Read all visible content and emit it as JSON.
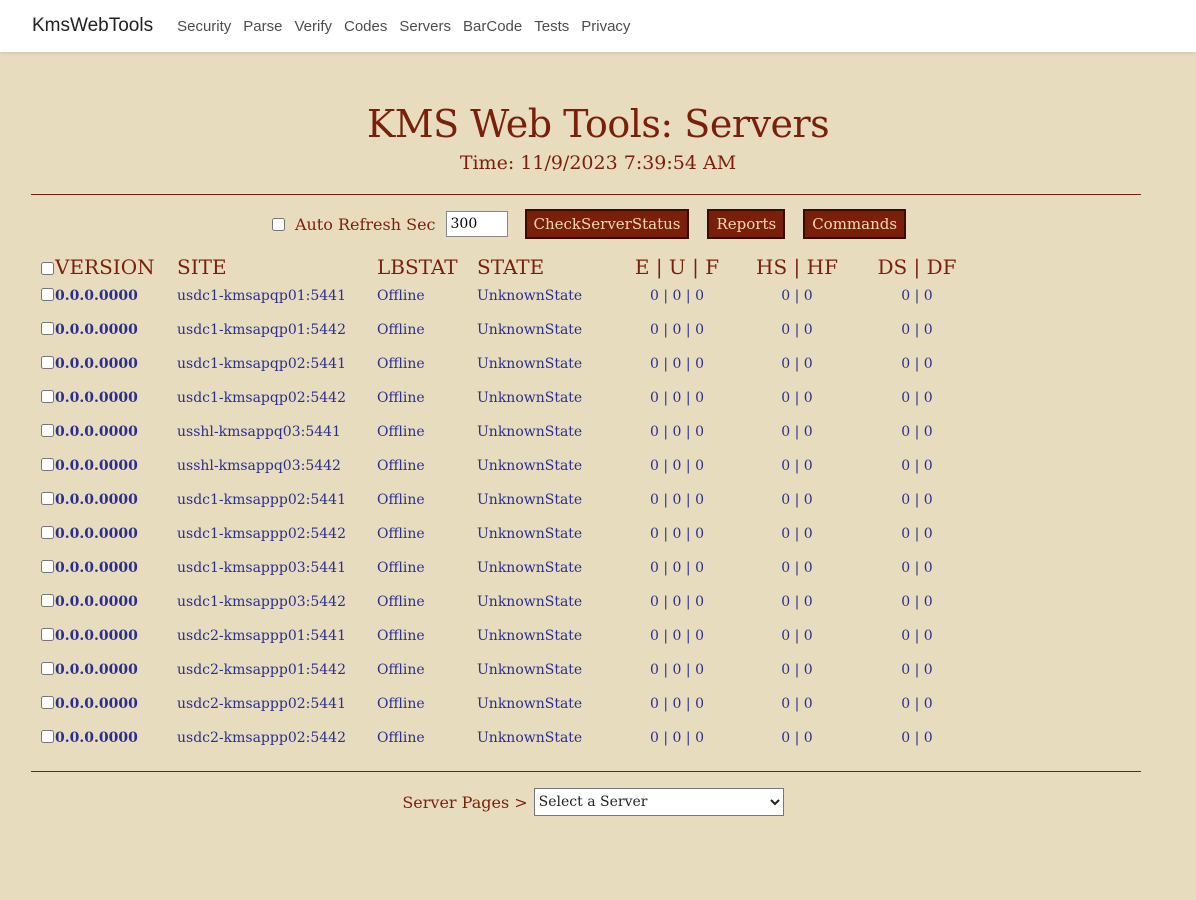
{
  "nav": {
    "brand": "KmsWebTools",
    "items": [
      {
        "label": "Security"
      },
      {
        "label": "Parse"
      },
      {
        "label": "Verify"
      },
      {
        "label": "Codes"
      },
      {
        "label": "Servers"
      },
      {
        "label": "BarCode"
      },
      {
        "label": "Tests"
      },
      {
        "label": "Privacy"
      }
    ]
  },
  "header": {
    "title": "KMS Web Tools: Servers",
    "time": "Time: 11/9/2023 7:39:54 AM"
  },
  "controls": {
    "auto_refresh_label": "Auto Refresh Sec",
    "auto_refresh_value": "300",
    "auto_refresh_checked": false,
    "check_status_label": "CheckServerStatus",
    "reports_label": "Reports",
    "commands_label": "Commands"
  },
  "table": {
    "headers": [
      "VERSION",
      "SITE",
      "LBSTAT",
      "STATE",
      "E | U | F",
      "HS | HF",
      "DS | DF"
    ],
    "rows": [
      {
        "version": "0.0.0.0000",
        "site": "usdc1-kmsapqp01:5441",
        "lbstat": "Offline",
        "state": "UnknownState",
        "euf": "0 | 0 | 0",
        "hshf": "0 | 0",
        "dsdf": "0 | 0"
      },
      {
        "version": "0.0.0.0000",
        "site": "usdc1-kmsapqp01:5442",
        "lbstat": "Offline",
        "state": "UnknownState",
        "euf": "0 | 0 | 0",
        "hshf": "0 | 0",
        "dsdf": "0 | 0"
      },
      {
        "version": "0.0.0.0000",
        "site": "usdc1-kmsapqp02:5441",
        "lbstat": "Offline",
        "state": "UnknownState",
        "euf": "0 | 0 | 0",
        "hshf": "0 | 0",
        "dsdf": "0 | 0"
      },
      {
        "version": "0.0.0.0000",
        "site": "usdc1-kmsapqp02:5442",
        "lbstat": "Offline",
        "state": "UnknownState",
        "euf": "0 | 0 | 0",
        "hshf": "0 | 0",
        "dsdf": "0 | 0"
      },
      {
        "version": "0.0.0.0000",
        "site": "usshl-kmsappq03:5441",
        "lbstat": "Offline",
        "state": "UnknownState",
        "euf": "0 | 0 | 0",
        "hshf": "0 | 0",
        "dsdf": "0 | 0"
      },
      {
        "version": "0.0.0.0000",
        "site": "usshl-kmsappq03:5442",
        "lbstat": "Offline",
        "state": "UnknownState",
        "euf": "0 | 0 | 0",
        "hshf": "0 | 0",
        "dsdf": "0 | 0"
      },
      {
        "version": "0.0.0.0000",
        "site": "usdc1-kmsappp02:5441",
        "lbstat": "Offline",
        "state": "UnknownState",
        "euf": "0 | 0 | 0",
        "hshf": "0 | 0",
        "dsdf": "0 | 0"
      },
      {
        "version": "0.0.0.0000",
        "site": "usdc1-kmsappp02:5442",
        "lbstat": "Offline",
        "state": "UnknownState",
        "euf": "0 | 0 | 0",
        "hshf": "0 | 0",
        "dsdf": "0 | 0"
      },
      {
        "version": "0.0.0.0000",
        "site": "usdc1-kmsappp03:5441",
        "lbstat": "Offline",
        "state": "UnknownState",
        "euf": "0 | 0 | 0",
        "hshf": "0 | 0",
        "dsdf": "0 | 0"
      },
      {
        "version": "0.0.0.0000",
        "site": "usdc1-kmsappp03:5442",
        "lbstat": "Offline",
        "state": "UnknownState",
        "euf": "0 | 0 | 0",
        "hshf": "0 | 0",
        "dsdf": "0 | 0"
      },
      {
        "version": "0.0.0.0000",
        "site": "usdc2-kmsappp01:5441",
        "lbstat": "Offline",
        "state": "UnknownState",
        "euf": "0 | 0 | 0",
        "hshf": "0 | 0",
        "dsdf": "0 | 0"
      },
      {
        "version": "0.0.0.0000",
        "site": "usdc2-kmsappp01:5442",
        "lbstat": "Offline",
        "state": "UnknownState",
        "euf": "0 | 0 | 0",
        "hshf": "0 | 0",
        "dsdf": "0 | 0"
      },
      {
        "version": "0.0.0.0000",
        "site": "usdc2-kmsappp02:5441",
        "lbstat": "Offline",
        "state": "UnknownState",
        "euf": "0 | 0 | 0",
        "hshf": "0 | 0",
        "dsdf": "0 | 0"
      },
      {
        "version": "0.0.0.0000",
        "site": "usdc2-kmsappp02:5442",
        "lbstat": "Offline",
        "state": "UnknownState",
        "euf": "0 | 0 | 0",
        "hshf": "0 | 0",
        "dsdf": "0 | 0"
      }
    ]
  },
  "server_pages": {
    "label": "Server Pages >",
    "selected": "Select a Server"
  },
  "colors": {
    "background": "#e8dcbf",
    "accent": "#7a1f0a",
    "link": "#2a2f8f",
    "button_text": "#f3d9b0"
  }
}
